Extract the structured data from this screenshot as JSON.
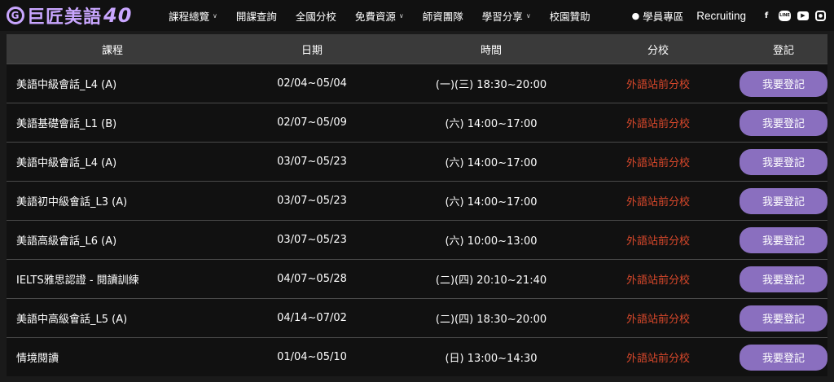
{
  "nav": {
    "logo_text": "巨匠美語",
    "logo_suffix": "40",
    "menu": [
      {
        "label": "課程總覽",
        "dropdown": true
      },
      {
        "label": "開課查詢",
        "dropdown": false
      },
      {
        "label": "全國分校",
        "dropdown": false
      },
      {
        "label": "免費資源",
        "dropdown": true
      },
      {
        "label": "師資團隊",
        "dropdown": false
      },
      {
        "label": "學習分享",
        "dropdown": true
      },
      {
        "label": "校園贊助",
        "dropdown": false
      }
    ],
    "member": "學員專區",
    "recruiting": "Recruiting",
    "social": [
      "facebook-icon",
      "line-icon",
      "youtube-icon",
      "instagram-icon"
    ]
  },
  "table": {
    "headers": [
      "課程",
      "日期",
      "時間",
      "分校",
      "登記"
    ],
    "rows": [
      {
        "course": "美語中級會話_L4 (A)",
        "date": "02/04~05/04",
        "time": "(一)(三) 18:30~20:00",
        "branch": "外語站前分校",
        "action": "我要登記"
      },
      {
        "course": "美語基礎會話_L1 (B)",
        "date": "02/07~05/09",
        "time": "(六) 14:00~17:00",
        "branch": "外語站前分校",
        "action": "我要登記"
      },
      {
        "course": "美語中級會話_L4 (A)",
        "date": "03/07~05/23",
        "time": "(六) 14:00~17:00",
        "branch": "外語站前分校",
        "action": "我要登記"
      },
      {
        "course": "美語初中級會話_L3 (A)",
        "date": "03/07~05/23",
        "time": "(六) 14:00~17:00",
        "branch": "外語站前分校",
        "action": "我要登記"
      },
      {
        "course": "美語高級會話_L6 (A)",
        "date": "03/07~05/23",
        "time": "(六) 10:00~13:00",
        "branch": "外語站前分校",
        "action": "我要登記"
      },
      {
        "course": "IELTS雅思認證 - 閱讀訓練",
        "date": "04/07~05/28",
        "time": "(二)(四) 20:10~21:40",
        "branch": "外語站前分校",
        "action": "我要登記"
      },
      {
        "course": "美語中高級會話_L5 (A)",
        "date": "04/14~07/02",
        "time": "(二)(四) 18:30~20:00",
        "branch": "外語站前分校",
        "action": "我要登記"
      },
      {
        "course": "情境閱讀",
        "date": "01/04~05/10",
        "time": "(日) 13:00~14:30",
        "branch": "外語站前分校",
        "action": "我要登記"
      }
    ]
  },
  "colors": {
    "accent": "#8a6fbf",
    "branch_text": "#d9482b",
    "logo": "#c9a6ff"
  }
}
